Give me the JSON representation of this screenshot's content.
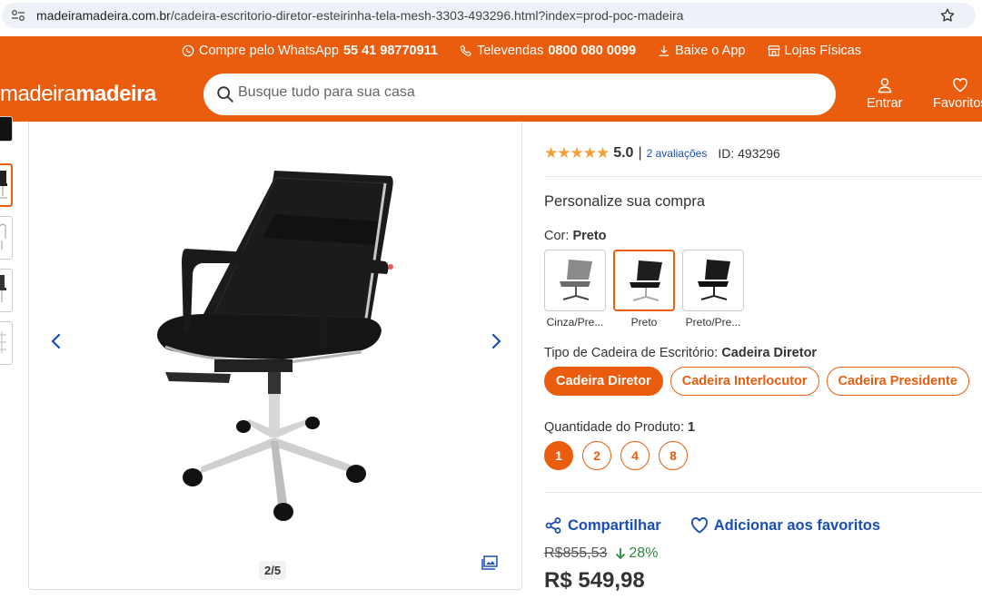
{
  "browser": {
    "url_domain": "madeiramadeira.com.br",
    "url_path": "/cadeira-escritorio-diretor-esteirinha-tela-mesh-3303-493296.html?index=prod-poc-madeira"
  },
  "promo": {
    "whatsapp_label": "Compre pelo WhatsApp",
    "whatsapp_number": "55 41 98770911",
    "televendas_label": "Televendas",
    "televendas_number": "0800 080 0099",
    "app_label": "Baixe o App",
    "stores_label": "Lojas Físicas"
  },
  "header": {
    "logo_light": "madeira",
    "logo_bold": "madeira",
    "search_placeholder": "Busque tudo para sua casa",
    "login_label": "Entrar",
    "favorites_label": "Favoritos"
  },
  "gallery": {
    "pager": "2/5"
  },
  "product": {
    "stars": "★★★★★",
    "score": "5.0",
    "separator": "|",
    "reviews": "2 avaliações",
    "id": "ID: 493296",
    "personalize_title": "Personalize sua compra",
    "color_label": "Cor:",
    "color_selected": "Preto",
    "swatches": [
      {
        "label": "Cinza/Pre..."
      },
      {
        "label": "Preto"
      },
      {
        "label": "Preto/Pre..."
      }
    ],
    "type_label": "Tipo de Cadeira de Escritório:",
    "type_selected": "Cadeira Diretor",
    "types": [
      "Cadeira Diretor",
      "Cadeira Interlocutor",
      "Cadeira Presidente"
    ],
    "qty_label": "Quantidade do Produto:",
    "qty_selected": "1",
    "qtys": [
      "1",
      "2",
      "4",
      "8"
    ],
    "share_label": "Compartilhar",
    "fav_label": "Adicionar aos favoritos",
    "old_price": "R$855,53",
    "discount": "28%",
    "price": "R$ 549,98"
  },
  "colors": {
    "brand": "#ea5d0f",
    "link": "#1a4db8",
    "discount": "#2b8a3e"
  }
}
